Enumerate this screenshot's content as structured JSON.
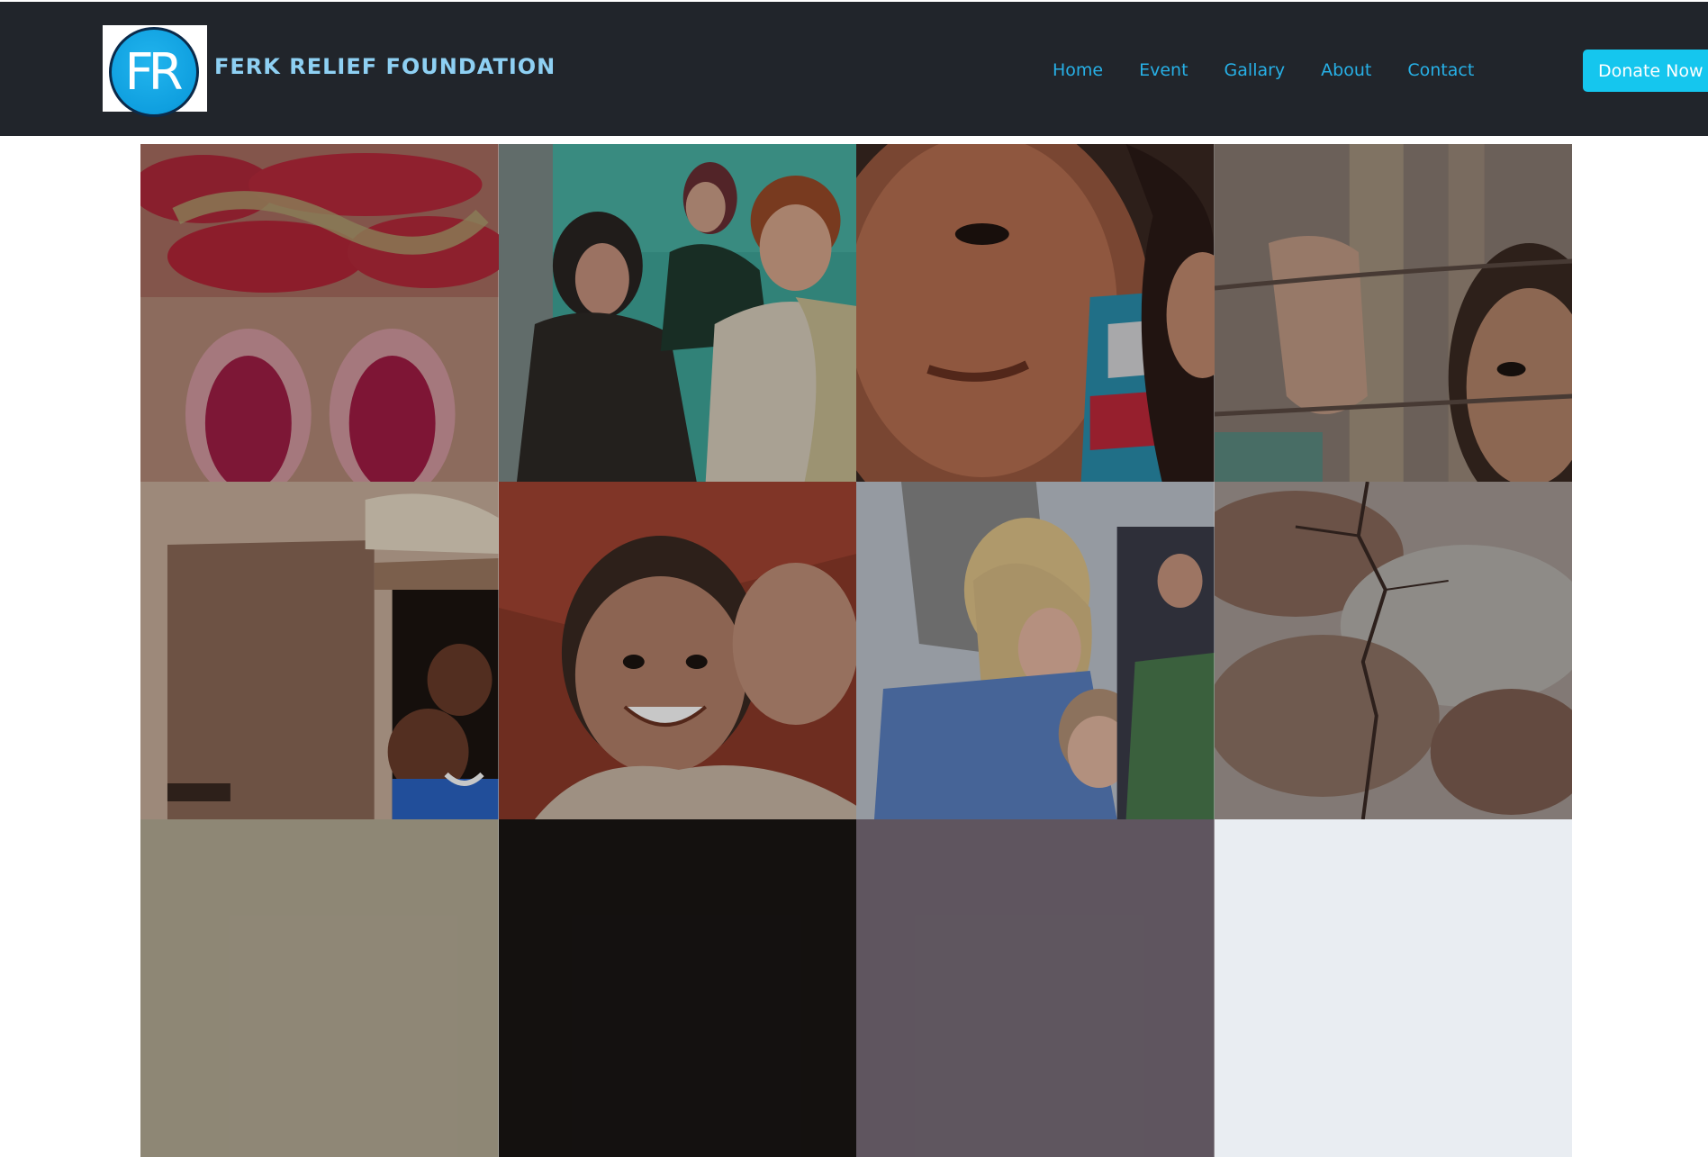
{
  "header": {
    "logo": {
      "text": "FR",
      "icon": "fr-logo-icon"
    },
    "brand": "FERK RELIEF FOUNDATION",
    "nav": [
      "Home",
      "Event",
      "Gallary",
      "About",
      "Contact"
    ],
    "donate_label": "Donate Now"
  },
  "colors": {
    "navbar_bg": "#21252b",
    "brand_text": "#8ed0f3",
    "nav_link": "#27b0e6",
    "donate_bg": "#15c6ee",
    "logo_blue": "#0f9fdf"
  },
  "gallery": {
    "tiles": [
      {
        "name": "red-sandals-photo"
      },
      {
        "name": "children-in-headscarves-photo"
      },
      {
        "name": "smiling-child-closeup-photo"
      },
      {
        "name": "boy-behind-barbed-wire-photo"
      },
      {
        "name": "children-in-doorway-photo"
      },
      {
        "name": "smiling-boy-pointing-photo"
      },
      {
        "name": "woman-with-children-photo"
      },
      {
        "name": "cracked-wall-photo"
      },
      {
        "name": "gallery-photo-9"
      },
      {
        "name": "gallery-photo-10"
      },
      {
        "name": "gallery-photo-11"
      },
      {
        "name": "gallery-photo-12"
      }
    ]
  }
}
